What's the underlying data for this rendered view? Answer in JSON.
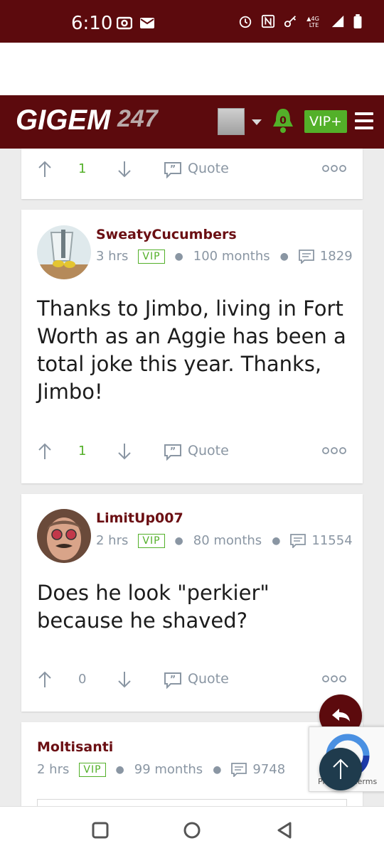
{
  "status_bar": {
    "time": "6:10",
    "network": "4G LTE"
  },
  "header": {
    "logo_text": "GIGEM",
    "logo_suffix": "247",
    "notification_count": "0",
    "vip_label": "VIP+"
  },
  "top_card": {
    "vote_count": "1",
    "quote_label": "Quote"
  },
  "posts": [
    {
      "username": "SweatyCucumbers",
      "time": "3 hrs",
      "badge": "VIP",
      "tenure": "100 months",
      "post_count": "1829",
      "body": "Thanks to Jimbo, living in Fort Worth as an Aggie has been a total joke this year. Thanks, Jimbo!",
      "vote_count": "1",
      "quote_label": "Quote"
    },
    {
      "username": "LimitUp007",
      "time": "2 hrs",
      "badge": "VIP",
      "tenure": "80 months",
      "post_count": "11554",
      "body": "Does he look \"perkier\" because he shaved?",
      "vote_count": "0",
      "quote_label": "Quote"
    },
    {
      "username": "Moltisanti",
      "time": "2 hrs",
      "badge": "VIP",
      "tenure": "99 months",
      "post_count": "9748"
    }
  ],
  "recaptcha": {
    "text": "Privacy - Terms"
  },
  "colors": {
    "brand_maroon": "#5c0a0d",
    "vip_green": "#53b029",
    "meta_gray": "#8a96a3",
    "scroll_top_fab": "#1f3b4d"
  }
}
